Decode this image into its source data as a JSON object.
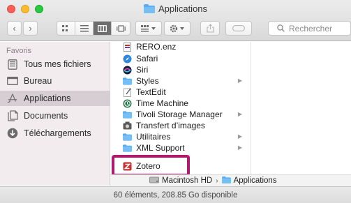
{
  "window": {
    "title": "Applications"
  },
  "toolbar": {
    "back_glyph": "‹",
    "forward_glyph": "›",
    "search_placeholder": "Rechercher"
  },
  "sidebar": {
    "header": "Favoris",
    "items": [
      {
        "label": "Tous mes fichiers",
        "icon": "all-files-icon"
      },
      {
        "label": "Bureau",
        "icon": "desktop-icon"
      },
      {
        "label": "Applications",
        "icon": "applications-icon",
        "selected": true
      },
      {
        "label": "Documents",
        "icon": "documents-icon"
      },
      {
        "label": "Téléchargements",
        "icon": "downloads-icon"
      }
    ]
  },
  "files": [
    {
      "name": "RERO.enz",
      "icon": "doc-icon"
    },
    {
      "name": "Safari",
      "icon": "safari-icon"
    },
    {
      "name": "Siri",
      "icon": "siri-icon"
    },
    {
      "name": "Styles",
      "icon": "folder-icon",
      "folder": true
    },
    {
      "name": "TextEdit",
      "icon": "textedit-icon"
    },
    {
      "name": "Time Machine",
      "icon": "time-machine-icon"
    },
    {
      "name": "Tivoli Storage Manager",
      "icon": "folder-icon",
      "folder": true
    },
    {
      "name": "Transfert d’images",
      "icon": "camera-icon"
    },
    {
      "name": "Utilitaires",
      "icon": "folder-icon",
      "folder": true
    },
    {
      "name": "XML Support",
      "icon": "folder-icon",
      "folder": true
    },
    {
      "name": "Zotero",
      "icon": "zotero-icon"
    }
  ],
  "pathbar": {
    "disk": "Macintosh HD",
    "folder": "Applications",
    "separator": "›"
  },
  "status": {
    "text": "60 éléments, 208.85 Go disponible"
  },
  "colors": {
    "highlight": "#b0196e",
    "sidebar_bg": "#f2ecef",
    "selection": "#d7ced4"
  }
}
